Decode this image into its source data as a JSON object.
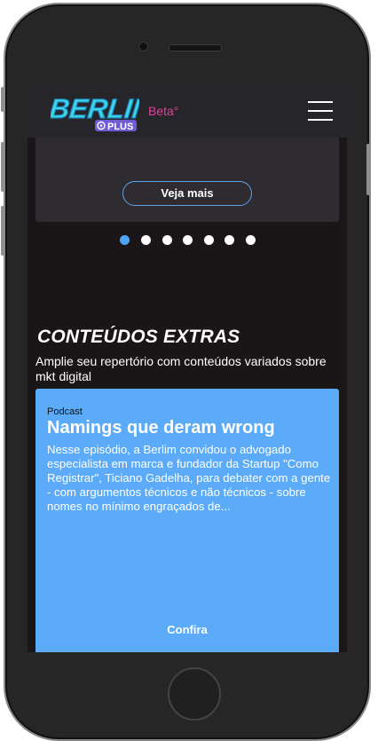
{
  "header": {
    "logo_text": "BERLIM",
    "logo_sub": "PLUS",
    "beta_label": "Beta°",
    "menu_icon": "hamburger-menu-icon"
  },
  "featured": {
    "button_label": "Veja mais"
  },
  "carousel": {
    "count": 7,
    "active_index": 0,
    "active_color": "#4aa4f8"
  },
  "extras": {
    "title": "CONTEÚDOS EXTRAS",
    "subtitle": "Amplie seu repertório com conteúdos variados sobre mkt digital"
  },
  "card": {
    "category": "Podcast",
    "title": "Namings que deram wrong",
    "description": "Nesse episódio, a Berlim convidou o advogado especialista em marca e fundador da Startup \"Como Registrar\", Ticiano Gadelha, para debater com a gente - com argumentos técnicos e não técnicos - sobre nomes no mínimo engraçados de...",
    "cta": "Confira",
    "background": "#5cabf8"
  },
  "colors": {
    "header_bg": "#26262a",
    "screen_bg": "#1a1517",
    "beta": "#e0409b",
    "logo_cyan": "#3dd3e8",
    "logo_purple": "#6e5cd6"
  }
}
